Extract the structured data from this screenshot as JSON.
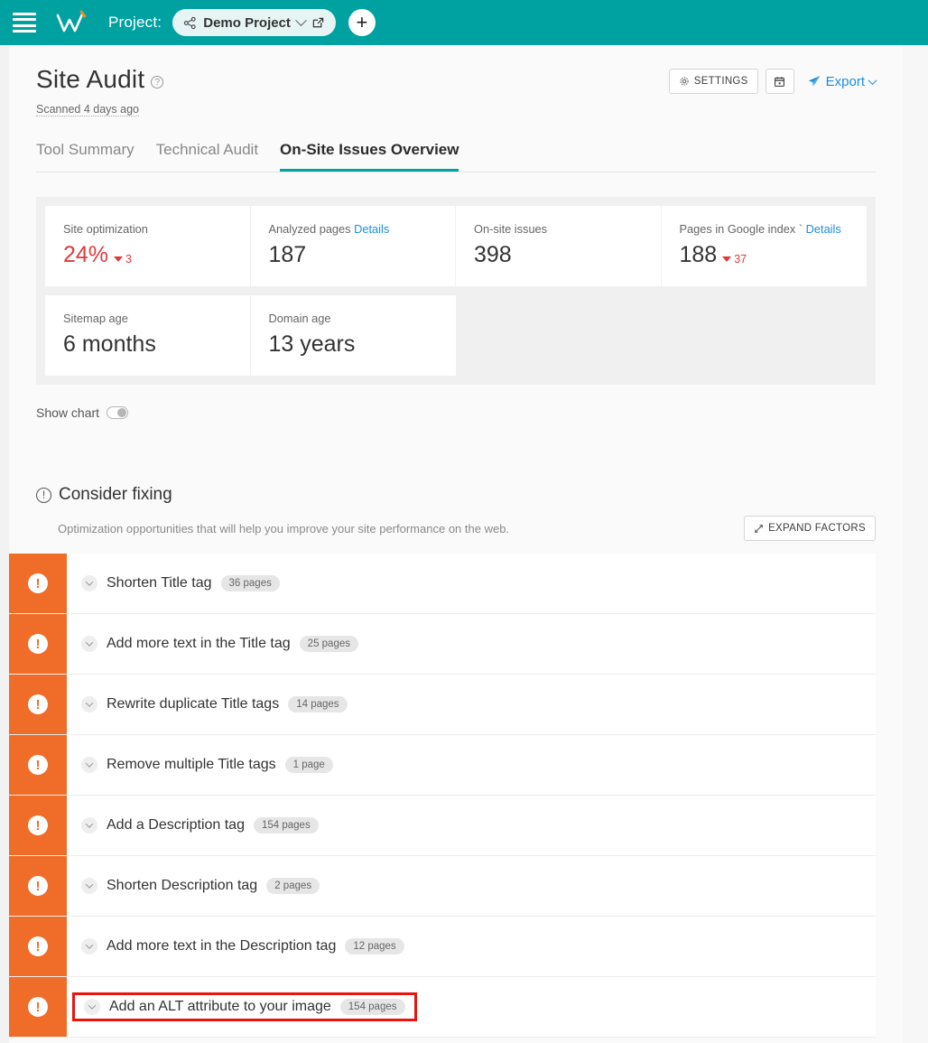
{
  "topbar": {
    "menu_icon": "hamburger-icon",
    "logo_text": "W",
    "project_label": "Project:",
    "project_name": "Demo Project",
    "share_icon": "share-nodes-icon",
    "external_icon": "external-link-icon",
    "add_label": "+",
    "accent_color": "#00a1a1"
  },
  "header": {
    "title": "Site Audit",
    "help_icon": "question-circle-icon",
    "scanned": "Scanned 4 days ago",
    "settings_label": "SETTINGS",
    "settings_icon": "gear-icon",
    "calendar_icon": "calendar-icon",
    "export_label": "Export",
    "export_icon": "paper-plane-icon"
  },
  "tabs": [
    {
      "label": "Tool Summary",
      "active": false
    },
    {
      "label": "Technical Audit",
      "active": false
    },
    {
      "label": "On-Site Issues Overview",
      "active": true
    }
  ],
  "metrics": [
    {
      "label": "Site optimization",
      "dotted": true,
      "details": "",
      "value": "24%",
      "red": true,
      "delta": "3",
      "delta_dir": "down"
    },
    {
      "label": "Analyzed pages",
      "dotted": true,
      "details": "Details",
      "value": "187",
      "red": false,
      "delta": "",
      "delta_dir": ""
    },
    {
      "label": "On-site issues",
      "dotted": false,
      "details": "",
      "value": "398",
      "red": false,
      "delta": "",
      "delta_dir": ""
    },
    {
      "label": "Pages in Google index `",
      "dotted": false,
      "details": "Details",
      "value": "188",
      "red": false,
      "delta": "37",
      "delta_dir": "down"
    },
    {
      "label": "Sitemap age",
      "dotted": false,
      "details": "",
      "value": "6 months",
      "red": false,
      "delta": "",
      "delta_dir": ""
    },
    {
      "label": "Domain age",
      "dotted": false,
      "details": "",
      "value": "13 years",
      "red": false,
      "delta": "",
      "delta_dir": ""
    }
  ],
  "show_chart": {
    "label": "Show chart",
    "enabled": false
  },
  "consider_fixing": {
    "title": "Consider fixing",
    "icon": "exclamation-circle-icon",
    "subtitle": "Optimization opportunities that will help you improve your site performance on the web.",
    "expand_label": "EXPAND FACTORS",
    "expand_icon": "expand-arrows-icon"
  },
  "issues": [
    {
      "severity_icon": "warning-icon",
      "name": "Shorten Title tag",
      "count": "36 pages",
      "highlighted": false
    },
    {
      "severity_icon": "warning-icon",
      "name": "Add more text in the Title tag",
      "count": "25 pages",
      "highlighted": false
    },
    {
      "severity_icon": "warning-icon",
      "name": "Rewrite duplicate Title tags",
      "count": "14 pages",
      "highlighted": false
    },
    {
      "severity_icon": "warning-icon",
      "name": "Remove multiple Title tags",
      "count": "1 page",
      "highlighted": false
    },
    {
      "severity_icon": "warning-icon",
      "name": "Add a Description tag",
      "count": "154 pages",
      "highlighted": false
    },
    {
      "severity_icon": "warning-icon",
      "name": "Shorten Description tag",
      "count": "2 pages",
      "highlighted": false
    },
    {
      "severity_icon": "warning-icon",
      "name": "Add more text in the Description tag",
      "count": "12 pages",
      "highlighted": false
    },
    {
      "severity_icon": "warning-icon",
      "name": "Add an ALT attribute to your image",
      "count": "154 pages",
      "highlighted": true
    }
  ],
  "colors": {
    "teal": "#00a1a1",
    "orange": "#ef6d28",
    "red": "#e03b3b",
    "link": "#1a8fe0",
    "highlight": "#e8150f"
  }
}
